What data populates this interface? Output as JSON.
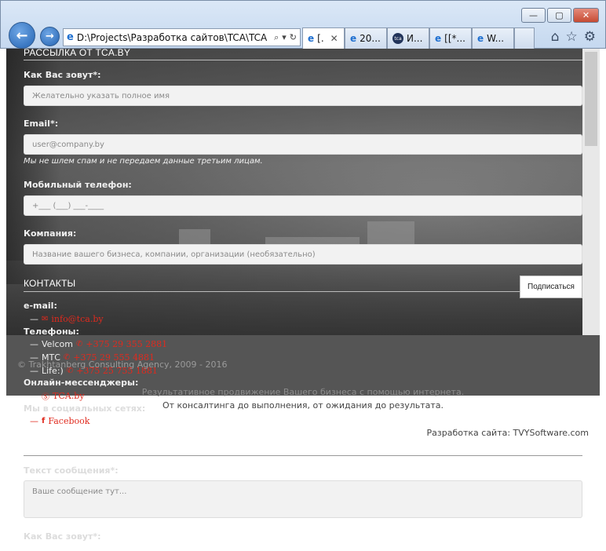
{
  "browser": {
    "address": "D:\\Projects\\Разработка сайтов\\TCA\\TCA",
    "tabs": [
      {
        "label": "[.",
        "active": true
      },
      {
        "label": "20..."
      },
      {
        "label": "И..."
      },
      {
        "label": "[[*..."
      },
      {
        "label": "W..."
      }
    ],
    "tca_icon_text": "tca"
  },
  "form": {
    "heading": "РАССЫЛКА ОТ TCA.BY",
    "name_label": "Как Вас зовут*:",
    "name_placeholder": "Желательно указать полное имя",
    "email_label": "Email*:",
    "email_placeholder": "user@company.by",
    "note": "Мы не шлем спам и не передаем данные третьим лицам.",
    "phone_label": "Мобильный телефон:",
    "phone_placeholder": "+___ (___) ___-____",
    "company_label": "Компания:",
    "company_placeholder": "Название вашего бизнеса, компании, организации (необязательно)",
    "subscribe_label": "Подписаться"
  },
  "contacts": {
    "heading": "КОНТАКТЫ",
    "email_label": "e-mail:",
    "email_value": "info@tca.by",
    "phones_label": "Телефоны:",
    "phones": [
      {
        "operator": "Velcom",
        "number": "+375 29 355 2881"
      },
      {
        "operator": "МТС",
        "number": "+375 29 555 4881"
      },
      {
        "operator": "Life:)",
        "number": "+375 25 755 1881"
      }
    ],
    "messengers_label": "Онлайн-мессенджеры:",
    "skype": "TCA.by",
    "social_label": "Мы в социальных сетях:",
    "facebook": "Facebook"
  },
  "footer": {
    "copyright": "© Trakhtanberg Consulting Agency, 2009 - 2016",
    "tagline_1": "Результативное продвижение Вашего бизнеса с помощью интернета.",
    "tagline_2": "От консалтинга до выполнения, от ожидания до результата.",
    "developer": "Разработка сайта: TVYSoftware.com"
  },
  "message_form": {
    "message_label": "Текст сообщения*:",
    "message_placeholder": "Ваше сообщение тут...",
    "name_label": "Как Вас зовут*:"
  },
  "colors": {
    "accent_red": "#e02a1e",
    "footer_bg": "#555555"
  }
}
